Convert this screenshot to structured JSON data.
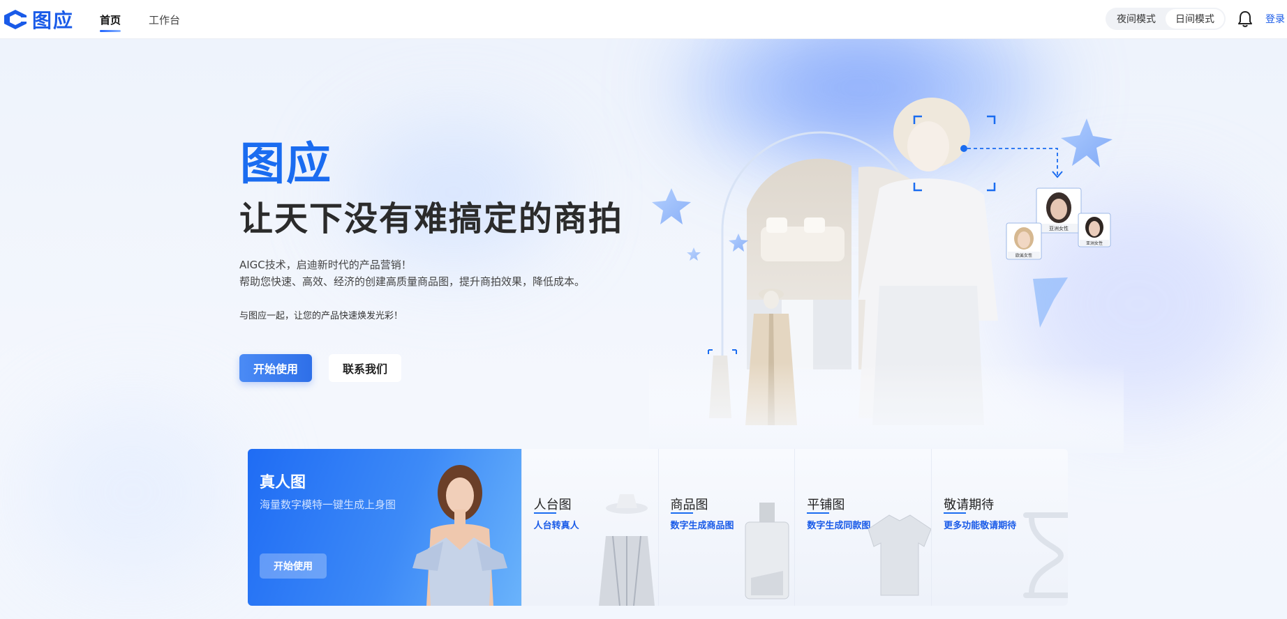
{
  "header": {
    "logo_text": "图应",
    "nav": [
      {
        "label": "首页",
        "active": true
      },
      {
        "label": "工作台",
        "active": false
      }
    ],
    "mode_toggle": {
      "night_label": "夜间模式",
      "day_label": "日间模式",
      "selected": "日间模式"
    },
    "login_label": "登录"
  },
  "hero": {
    "title": "图应",
    "subtitle": "让天下没有难搞定的商拍",
    "description_line1": "AIGC技术，启迪新时代的产品营销！",
    "description_line2": "帮助您快速、高效、经济的创建高质量商品图，提升商拍效果，降低成本。",
    "tagline": "与图应一起，让您的产品快速焕发光彩！",
    "primary_button": "开始使用",
    "secondary_button": "联系我们",
    "avatar_labels": [
      "亚洲女性",
      "欧美女性",
      "亚洲女性"
    ]
  },
  "features": {
    "main": {
      "title": "真人图",
      "description": "海量数字模特一键生成上身图",
      "button": "开始使用"
    },
    "cards": [
      {
        "title": "人台图",
        "description": "人台转真人"
      },
      {
        "title": "商品图",
        "description": "数字生成商品图"
      },
      {
        "title": "平铺图",
        "description": "数字生成同款图"
      },
      {
        "title": "敬请期待",
        "description": "更多功能敬请期待"
      }
    ]
  },
  "colors": {
    "brand": "#1a6cf0",
    "accent_blue": "#1a5be8",
    "card_gradient_start": "#1f6cf4"
  }
}
